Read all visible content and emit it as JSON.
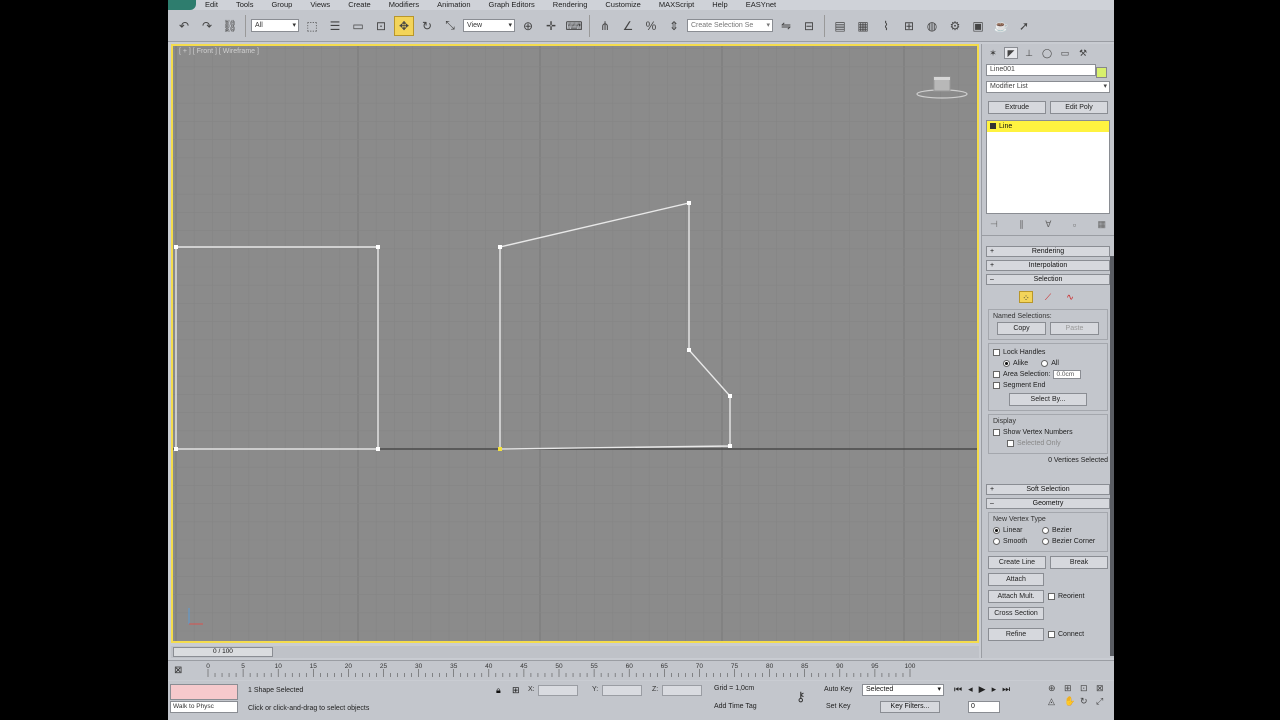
{
  "menu": {
    "items": [
      "Edit",
      "Tools",
      "Group",
      "Views",
      "Create",
      "Modifiers",
      "Animation",
      "Graph Editors",
      "Rendering",
      "Customize",
      "MAXScript",
      "Help",
      "EASYnet"
    ]
  },
  "toolbar": {
    "selection_filter": "All",
    "reference_coord": "View",
    "named_selection_placeholder": "Create Selection Se"
  },
  "viewport": {
    "label": "[ + ] [ Front ] [ Wireframe ]"
  },
  "command_panel": {
    "object_name": "Line001",
    "modifier_list": "Modifier List",
    "quick_buttons": [
      "Extrude",
      "Edit Poly"
    ],
    "stack_item": "Line",
    "rollouts": {
      "rendering": "Rendering",
      "interpolation": "Interpolation",
      "selection": "Selection",
      "soft_selection": "Soft Selection",
      "geometry": "Geometry"
    },
    "named_selections": {
      "title": "Named Selections:",
      "copy": "Copy",
      "paste": "Paste"
    },
    "lock_handles": "Lock Handles",
    "alike": "Alike",
    "all": "All",
    "area_selection": "Area Selection:",
    "area_value": "0.0cm",
    "segment_end": "Segment End",
    "select_by": "Select By...",
    "display": {
      "title": "Display",
      "show_vertex_numbers": "Show Vertex Numbers",
      "selected_only": "Selected Only"
    },
    "vertices_selected": "0 Vertices Selected",
    "new_vertex_type": {
      "title": "New Vertex Type",
      "linear": "Linear",
      "bezier": "Bezier",
      "smooth": "Smooth",
      "bezier_corner": "Bezier Corner"
    },
    "geometry_buttons": {
      "create_line": "Create Line",
      "break": "Break",
      "attach": "Attach",
      "attach_mult": "Attach Mult.",
      "reorient": "Reorient",
      "cross_section": "Cross Section",
      "refine": "Refine",
      "connect": "Connect"
    }
  },
  "timeline": {
    "slider_label": "0 / 100",
    "ticks": [
      0,
      5,
      10,
      15,
      20,
      25,
      30,
      35,
      40,
      45,
      50,
      55,
      60,
      65,
      70,
      75,
      80,
      85,
      90,
      95,
      100
    ]
  },
  "status": {
    "maxscript_text": "Walk to Physc",
    "selection_count": "1 Shape Selected",
    "prompt": "Click or click-and-drag to select objects",
    "x_label": "X:",
    "y_label": "Y:",
    "z_label": "Z:",
    "grid": "Grid = 1,0cm",
    "add_time_tag": "Add Time Tag",
    "auto_key": "Auto Key",
    "set_key": "Set Key",
    "key_mode": "Selected",
    "key_filters": "Key Filters...",
    "frame": "0"
  },
  "icons": {
    "select_move": "move-icon",
    "rotate": "rotate-icon",
    "scale": "scale-icon",
    "key": "key-icon"
  },
  "colors": {
    "viewport_border": "#f4dc4c",
    "viewport_bg": "#8b8b8b",
    "shape_lines": "#e8e8e8",
    "stack_highlight": "#fff340"
  }
}
